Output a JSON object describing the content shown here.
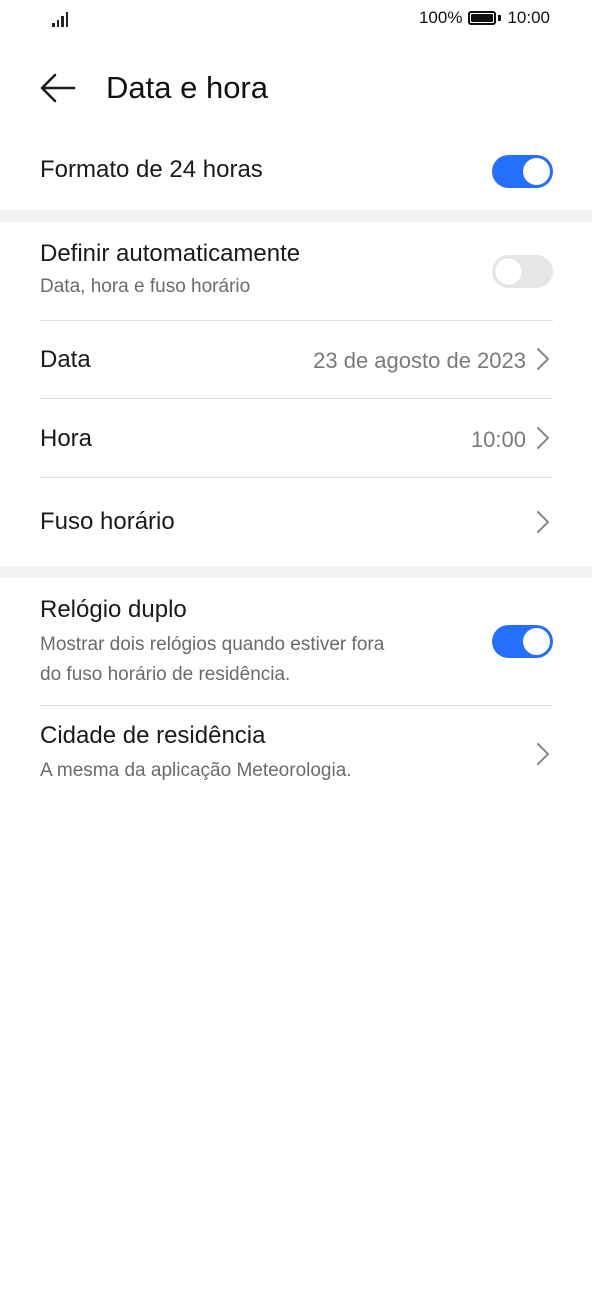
{
  "status_bar": {
    "battery_percent": "100%",
    "time": "10:00",
    "signal_icon": "signal-bars-icon",
    "battery_icon": "battery-full-icon"
  },
  "header": {
    "back_icon": "arrow-left-icon",
    "title": "Data e hora"
  },
  "settings": {
    "format_24h": {
      "label": "Formato de 24 horas",
      "enabled": true
    },
    "auto_set": {
      "label": "Definir automaticamente",
      "sublabel": "Data, hora e fuso horário",
      "enabled": false
    },
    "date": {
      "label": "Data",
      "value": "23 de agosto de 2023"
    },
    "time": {
      "label": "Hora",
      "value": "10:00"
    },
    "timezone": {
      "label": "Fuso horário",
      "value": ""
    },
    "dual_clock": {
      "label": "Relógio duplo",
      "sublabel_line1": "Mostrar dois relógios quando estiver fora",
      "sublabel_line2": "do fuso horário de residência.",
      "enabled": true
    },
    "home_city": {
      "label": "Cidade de residência",
      "sublabel": "A mesma da aplicação Meteorologia."
    }
  },
  "colors": {
    "accent": "#256fff",
    "toggle_off": "#e6e6e6",
    "section_gap": "#f2f2f2"
  }
}
